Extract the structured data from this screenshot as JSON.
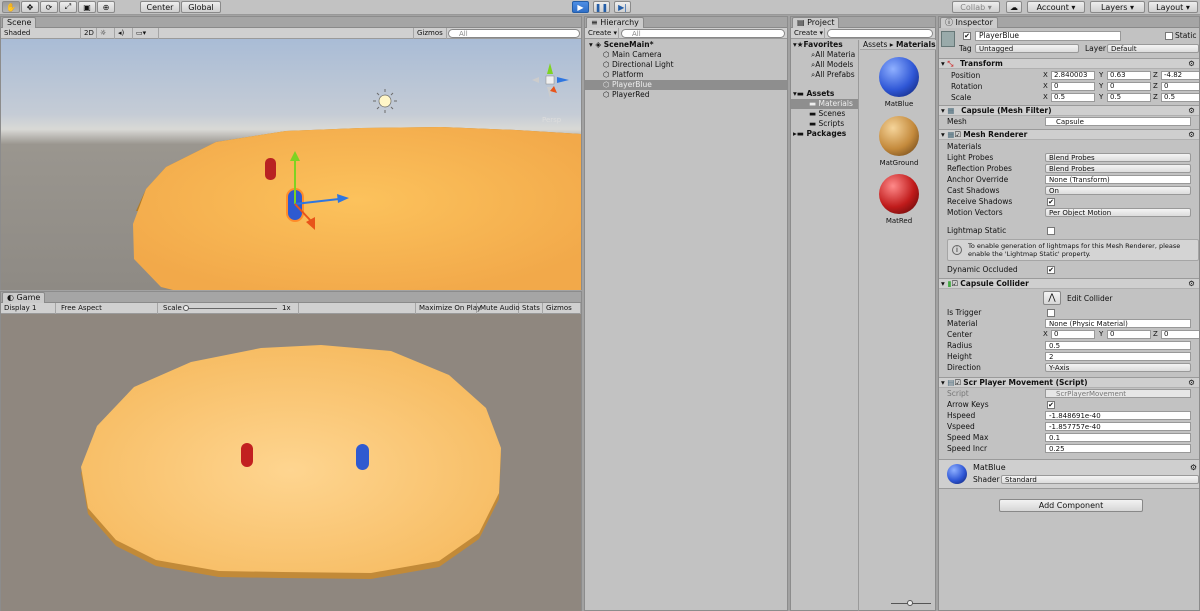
{
  "toolbar": {
    "pivot": "Center",
    "space": "Global",
    "collab": "Collab",
    "account": "Account",
    "layers": "Layers",
    "layout": "Layout"
  },
  "scene": {
    "tab": "Scene",
    "shading": "Shaded",
    "mode2d": "2D",
    "gizmos": "Gizmos",
    "search_placeholder": "All",
    "persp": "Persp"
  },
  "game": {
    "tab": "Game",
    "display": "Display 1",
    "aspect": "Free Aspect",
    "scale_label": "Scale",
    "scale_value": "1x",
    "maximize": "Maximize On Play",
    "mute": "Mute Audio",
    "stats": "Stats",
    "gizmos": "Gizmos"
  },
  "hierarchy": {
    "tab": "Hierarchy",
    "create": "Create",
    "search_placeholder": "All",
    "scene_name": "SceneMain*",
    "items": [
      "Main Camera",
      "Directional Light",
      "Platform",
      "PlayerBlue",
      "PlayerRed"
    ]
  },
  "project": {
    "tab": "Project",
    "create": "Create",
    "favorites": "Favorites",
    "fav_items": [
      "All Materia",
      "All Models",
      "All Prefabs"
    ],
    "assets": "Assets",
    "asset_items": [
      "Materials",
      "Scenes",
      "Scripts"
    ],
    "packages": "Packages",
    "breadcrumb_root": "Assets",
    "breadcrumb_current": "Materials",
    "materials": [
      {
        "name": "MatBlue",
        "color": "#2f57d6"
      },
      {
        "name": "MatGround",
        "color": "#d49a4a"
      },
      {
        "name": "MatRed",
        "color": "#c01b1b"
      }
    ]
  },
  "inspector": {
    "tab": "Inspector",
    "object_name": "PlayerBlue",
    "static": "Static",
    "tag_label": "Tag",
    "tag": "Untagged",
    "layer_label": "Layer",
    "layer": "Default",
    "transform": {
      "title": "Transform",
      "position_label": "Position",
      "rotation_label": "Rotation",
      "scale_label": "Scale",
      "position": [
        "2.840003",
        "0.63",
        "-4.82"
      ],
      "rotation": [
        "0",
        "0",
        "0"
      ],
      "scale": [
        "0.5",
        "0.5",
        "0.5"
      ]
    },
    "mesh_filter": {
      "title": "Capsule (Mesh Filter)",
      "mesh_label": "Mesh",
      "mesh": "Capsule"
    },
    "mesh_renderer": {
      "title": "Mesh Renderer",
      "materials": "Materials",
      "light_probes_label": "Light Probes",
      "light_probes": "Blend Probes",
      "reflection_label": "Reflection Probes",
      "reflection": "Blend Probes",
      "anchor_label": "Anchor Override",
      "anchor": "None (Transform)",
      "cast_label": "Cast Shadows",
      "cast": "On",
      "receive_label": "Receive Shadows",
      "motion_label": "Motion Vectors",
      "motion": "Per Object Motion",
      "lightmap_label": "Lightmap Static",
      "info": "To enable generation of lightmaps for this Mesh Renderer, please enable the 'Lightmap Static' property.",
      "occluded_label": "Dynamic Occluded"
    },
    "capsule_collider": {
      "title": "Capsule Collider",
      "edit": "Edit Collider",
      "trigger_label": "Is Trigger",
      "material_label": "Material",
      "material": "None (Physic Material)",
      "center_label": "Center",
      "center": [
        "0",
        "0",
        "0"
      ],
      "radius_label": "Radius",
      "radius": "0.5",
      "height_label": "Height",
      "height": "2",
      "direction_label": "Direction",
      "direction": "Y-Axis"
    },
    "script": {
      "title": "Scr Player Movement (Script)",
      "script_label": "Script",
      "script": "ScrPlayerMovement",
      "arrow_label": "Arrow Keys",
      "hspeed_label": "Hspeed",
      "hspeed": "-1.848691e-40",
      "vspeed_label": "Vspeed",
      "vspeed": "-1.857757e-40",
      "max_label": "Speed Max",
      "max": "0.1",
      "incr_label": "Speed Incr",
      "incr": "0.25"
    },
    "material": {
      "name": "MatBlue",
      "shader_label": "Shader",
      "shader": "Standard"
    },
    "add_component": "Add Component"
  }
}
